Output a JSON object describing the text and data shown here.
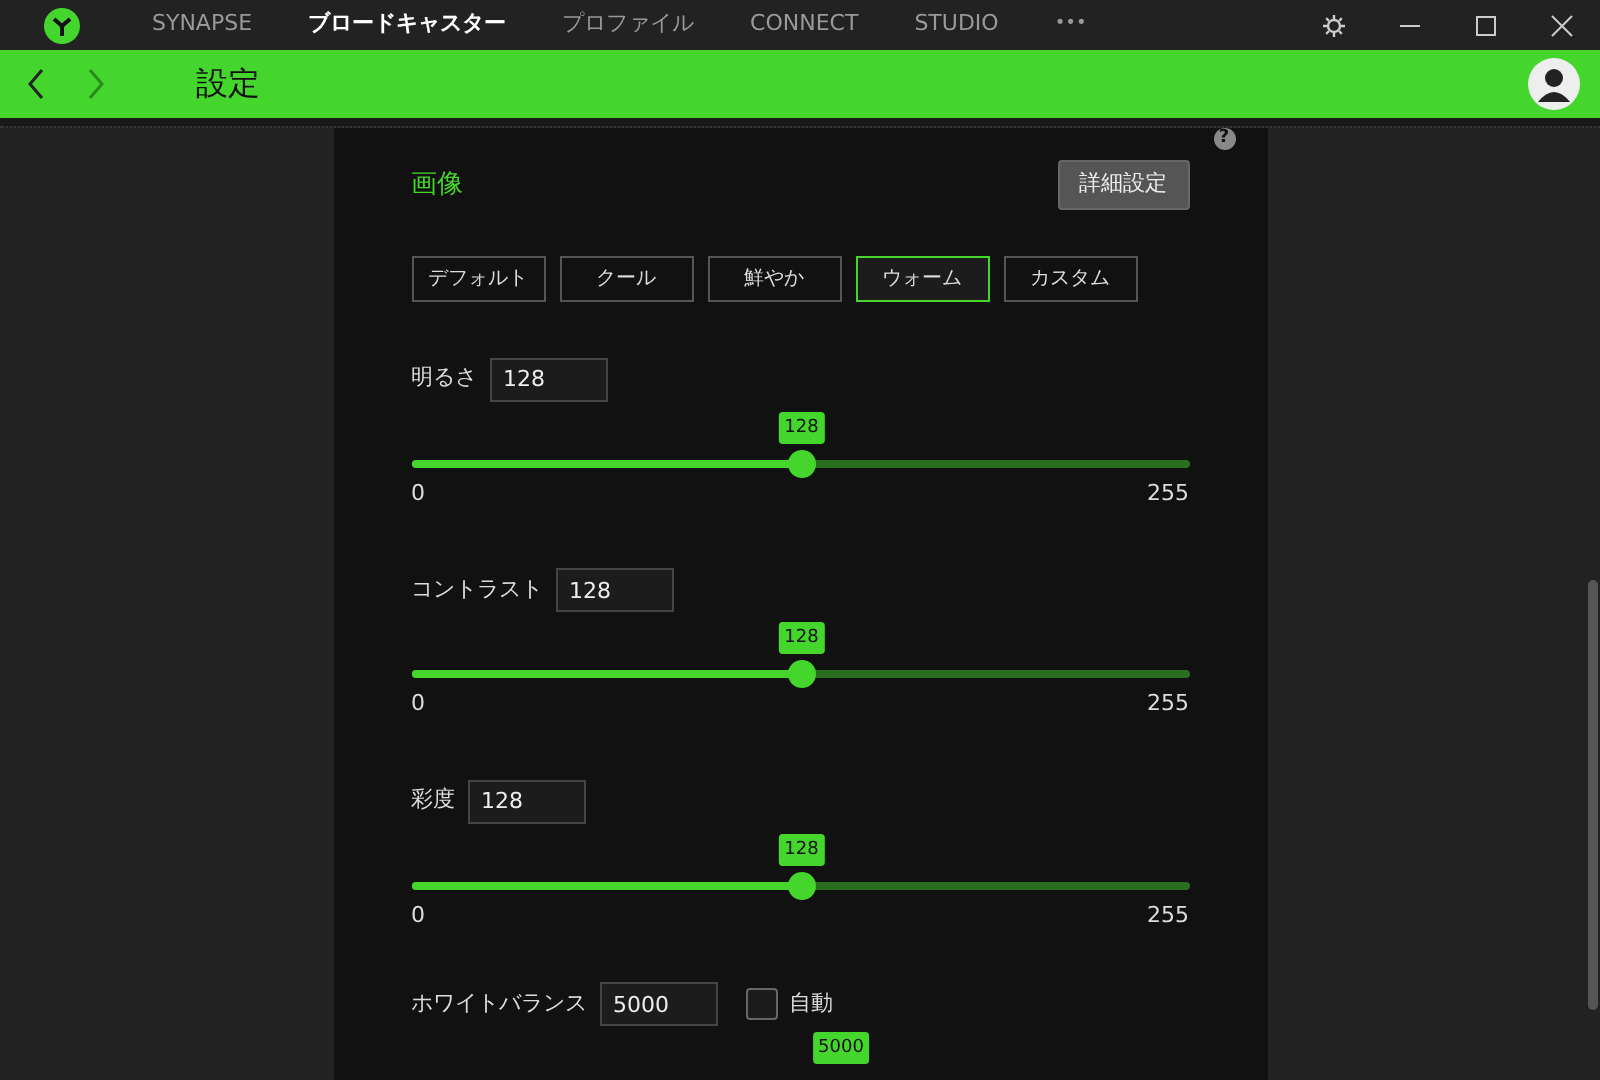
{
  "titlebar": {
    "tabs": [
      {
        "label": "SYNAPSE",
        "selected": false
      },
      {
        "label": "ブロードキャスター",
        "selected": true
      },
      {
        "label": "プロファイル",
        "selected": false
      },
      {
        "label": "CONNECT",
        "selected": false
      },
      {
        "label": "STUDIO",
        "selected": false
      }
    ],
    "more": "•••"
  },
  "header": {
    "title": "設定",
    "back_disabled": false,
    "forward_disabled": true
  },
  "section": {
    "help": "?",
    "title": "画像",
    "advanced_button": "詳細設定",
    "presets": [
      {
        "label": "デフォルト",
        "selected": false
      },
      {
        "label": "クール",
        "selected": false
      },
      {
        "label": "鮮やか",
        "selected": false
      },
      {
        "label": "ウォーム",
        "selected": true
      },
      {
        "label": "カスタム",
        "selected": false
      }
    ],
    "sliders": [
      {
        "label": "明るさ",
        "value": "128",
        "bubble": "128",
        "level": 0.502,
        "min": "0",
        "max": "255"
      },
      {
        "label": "コントラスト",
        "value": "128",
        "bubble": "128",
        "level": 0.502,
        "min": "0",
        "max": "255"
      },
      {
        "label": "彩度",
        "value": "128",
        "bubble": "128",
        "level": 0.502,
        "min": "0",
        "max": "255"
      }
    ],
    "white_balance": {
      "label": "ホワイトバランス",
      "value": "5000",
      "auto_label": "自動",
      "auto_checked": false,
      "bubble": "5000"
    }
  }
}
